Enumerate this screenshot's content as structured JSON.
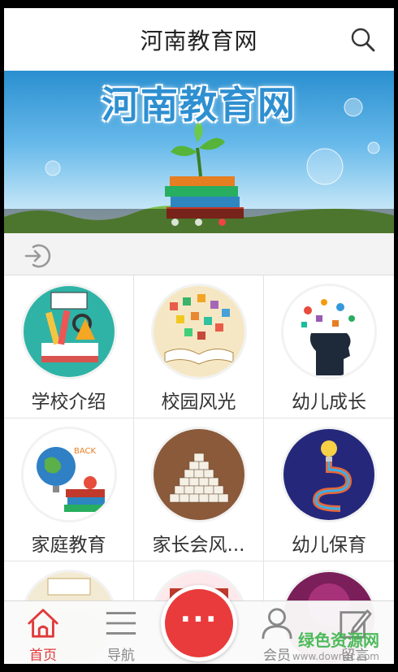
{
  "header": {
    "title": "河南教育网",
    "search_icon": "search-icon"
  },
  "banner": {
    "title": "河南教育网",
    "slide_count": 3,
    "active_slide": 3
  },
  "logout_bar": {
    "icon": "logout-icon"
  },
  "grid": {
    "items": [
      {
        "label": "学校介绍",
        "icon": "back-to-school-thumb"
      },
      {
        "label": "校园风光",
        "icon": "open-book-thumb"
      },
      {
        "label": "幼儿成长",
        "icon": "head-ideas-thumb"
      },
      {
        "label": "家庭教育",
        "icon": "globe-books-thumb"
      },
      {
        "label": "家长会风...",
        "icon": "alphabet-blocks-thumb"
      },
      {
        "label": "幼儿保育",
        "icon": "education-lightbulb-thumb"
      },
      {
        "label": "",
        "icon": "partial-thumb-1"
      },
      {
        "label": "",
        "icon": "partial-thumb-2"
      },
      {
        "label": "",
        "icon": "partial-thumb-3"
      }
    ]
  },
  "tabbar": {
    "items": [
      {
        "label": "首页",
        "icon": "home-icon",
        "active": true
      },
      {
        "label": "导航",
        "icon": "menu-icon",
        "active": false
      },
      {
        "label": "",
        "icon": "more-icon",
        "active": false
      },
      {
        "label": "会员",
        "icon": "user-icon",
        "active": false
      },
      {
        "label": "留言",
        "icon": "edit-icon",
        "active": false
      }
    ],
    "center_label": "···"
  },
  "watermark": {
    "line1": "绿色资源网",
    "line2": "www.downcc.com"
  },
  "colors": {
    "accent": "#e93b3b",
    "banner_sky": "#2a8fd0"
  }
}
